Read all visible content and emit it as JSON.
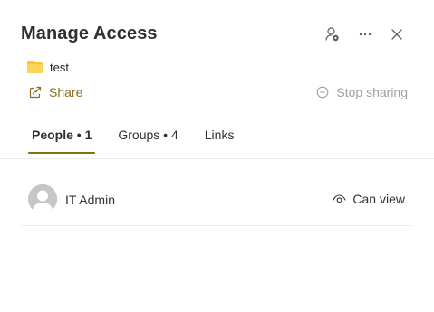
{
  "panel": {
    "title": "Manage Access"
  },
  "header_icons": [
    "people-settings-icon",
    "more-icon",
    "close-icon"
  ],
  "item": {
    "icon": "folder-icon",
    "name": "test"
  },
  "actions": {
    "share_label": "Share",
    "stop_sharing_label": "Stop sharing"
  },
  "tabs": [
    {
      "label": "People • 1",
      "active": true
    },
    {
      "label": "Groups • 4",
      "active": false
    },
    {
      "label": "Links",
      "active": false
    }
  ],
  "people": [
    {
      "name": "IT Admin",
      "permission": "Can view",
      "permission_icon": "eye-icon"
    }
  ],
  "colors": {
    "accent": "#8a6c1e",
    "folder": "#f8c43a",
    "disabled": "#a19f9d"
  }
}
